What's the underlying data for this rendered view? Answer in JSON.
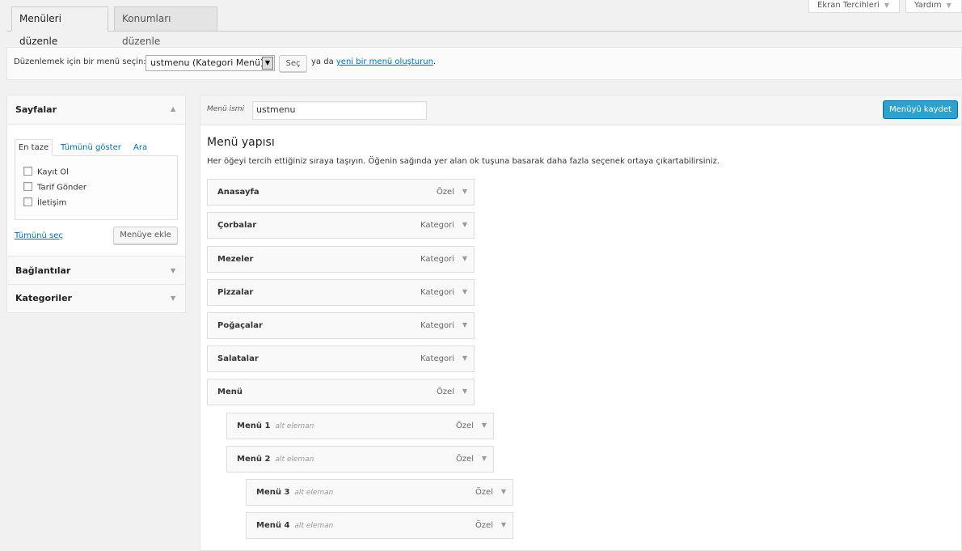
{
  "screen_meta": {
    "screen_options": "Ekran Tercihleri",
    "help": "Yardım"
  },
  "tabs": [
    {
      "label": "Menüleri düzenle",
      "active": true
    },
    {
      "label": "Konumları düzenle",
      "active": false
    }
  ],
  "select_bar": {
    "label": "Düzenlemek için bir menü seçin:",
    "selected_menu": "ustmenu (Kategori Menü)",
    "select_button": "Seç",
    "or_text": "ya da",
    "create_link": "yeni bir menü oluşturun",
    "period": "."
  },
  "sidebar": {
    "pages": {
      "title": "Sayfalar",
      "tabs": [
        "En taze",
        "Tümünü göster",
        "Ara"
      ],
      "items": [
        "Kayıt Ol",
        "Tarif Gönder",
        "İletişim"
      ],
      "select_all": "Tümünü seç",
      "add_button": "Menüye ekle"
    },
    "links": {
      "title": "Bağlantılar"
    },
    "categories": {
      "title": "Kategoriler"
    }
  },
  "editor": {
    "name_label": "Menü ismi",
    "name_value": "ustmenu",
    "save_button": "Menüyü kaydet",
    "structure_title": "Menü yapısı",
    "structure_desc": "Her öğeyi tercih ettiğiniz sıraya taşıyın. Öğenin sağında yer alan ok tuşuna basarak daha fazla seçenek ortaya çıkartabilirsiniz."
  },
  "menu_items": [
    {
      "title": "Anasayfa",
      "type": "Özel",
      "sub": ""
    },
    {
      "title": "Çorbalar",
      "type": "Kategori",
      "sub": ""
    },
    {
      "title": "Mezeler",
      "type": "Kategori",
      "sub": ""
    },
    {
      "title": "Pizzalar",
      "type": "Kategori",
      "sub": ""
    },
    {
      "title": "Poğaçalar",
      "type": "Kategori",
      "sub": ""
    },
    {
      "title": "Salatalar",
      "type": "Kategori",
      "sub": ""
    },
    {
      "title": "Menü",
      "type": "Özel",
      "sub": ""
    },
    {
      "title": "Menü 1",
      "type": "Özel",
      "sub": "alt eleman"
    },
    {
      "title": "Menü 2",
      "type": "Özel",
      "sub": "alt eleman"
    },
    {
      "title": "Menü 3",
      "type": "Özel",
      "sub": "alt eleman"
    },
    {
      "title": "Menü 4",
      "type": "Özel",
      "sub": "alt eleman"
    }
  ],
  "colors": {
    "accent": "#2ea2cc",
    "link": "#0073aa"
  }
}
